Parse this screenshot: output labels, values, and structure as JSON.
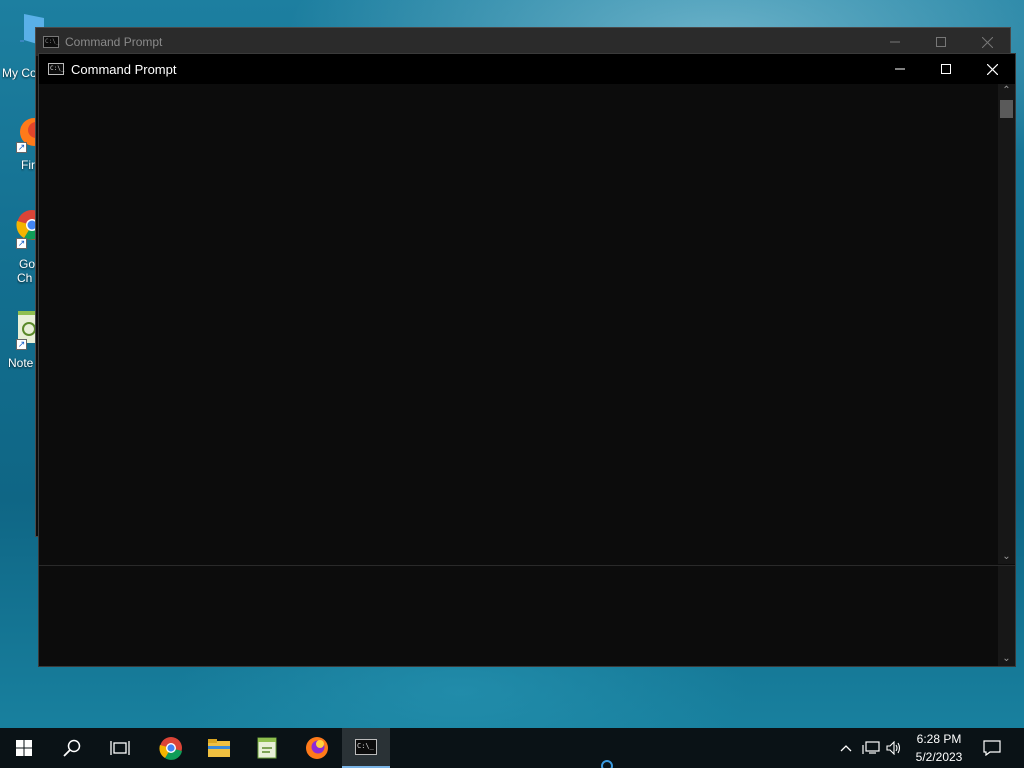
{
  "desktop": {
    "icons": [
      {
        "label": "My Co",
        "icon": "computer-icon"
      },
      {
        "label": "Fir",
        "icon": "firefox-icon"
      },
      {
        "label": "Go",
        "label2": "Ch",
        "icon": "chrome-icon"
      },
      {
        "label": "Note",
        "icon": "notepad-icon"
      }
    ]
  },
  "back_window": {
    "title": "Command Prompt"
  },
  "main_window": {
    "title": "Command Prompt"
  },
  "taskbar": {
    "apps": [
      "start-icon",
      "search-icon",
      "task-view-icon",
      "chrome-icon",
      "file-explorer-icon",
      "notepad-icon",
      "firefox-icon",
      "command-prompt-icon"
    ],
    "clock": {
      "time": "6:28 PM",
      "date": "5/2/2023"
    }
  },
  "colors": {
    "accent": "#7ab4e6",
    "console_bg": "#0c0c0c"
  }
}
